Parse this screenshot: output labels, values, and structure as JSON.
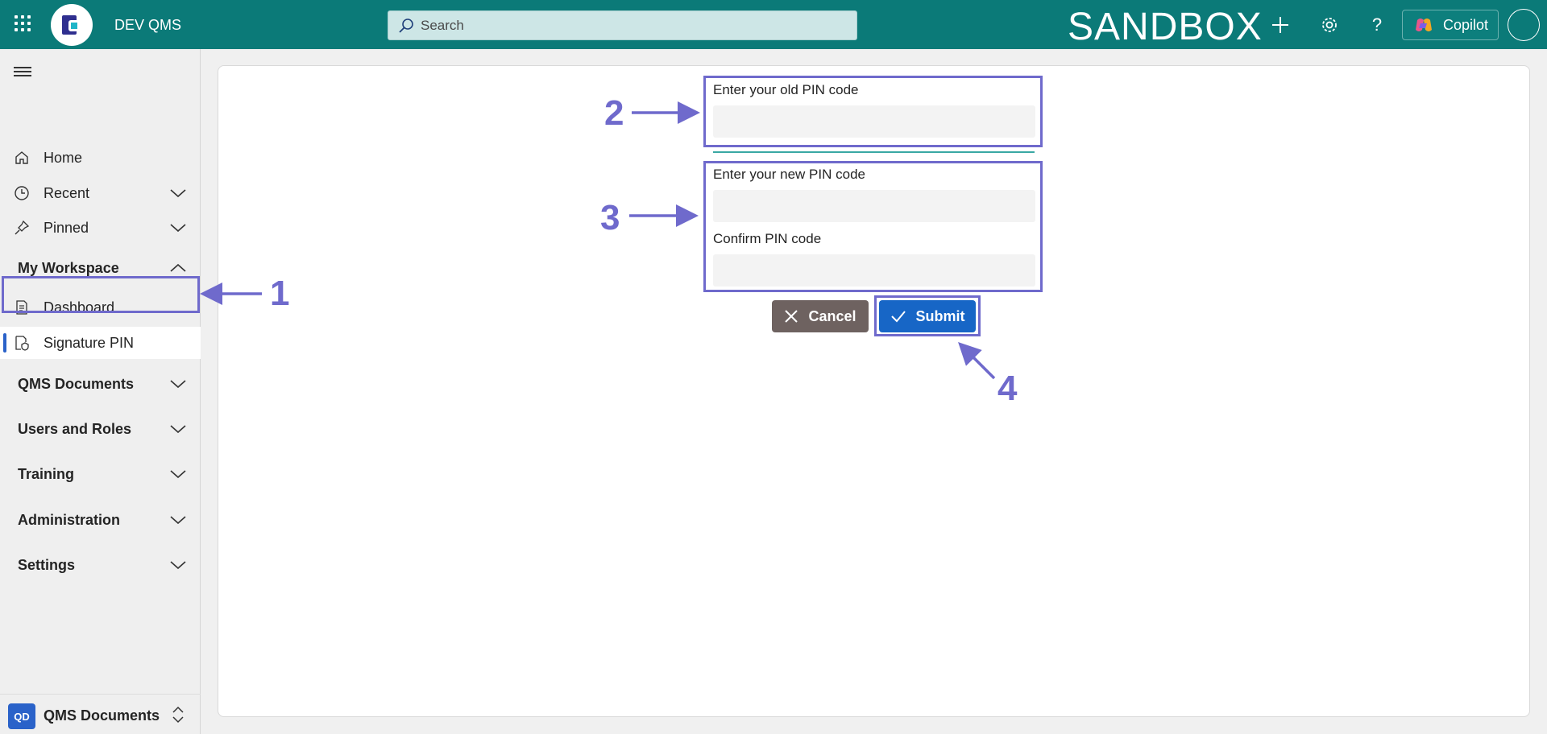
{
  "topbar": {
    "app_name": "DEV QMS",
    "search_placeholder": "Search",
    "environment": "SANDBOX",
    "copilot_label": "Copilot"
  },
  "sidebar": {
    "items": [
      {
        "label": "Home",
        "icon": "home-icon"
      },
      {
        "label": "Recent",
        "icon": "clock-icon"
      },
      {
        "label": "Pinned",
        "icon": "pin-icon"
      }
    ],
    "group_workspace": "My Workspace",
    "workspace_items": [
      {
        "label": "Dashboard",
        "icon": "dashboard-icon"
      },
      {
        "label": "Signature PIN",
        "icon": "shield-document-icon",
        "selected": true
      }
    ],
    "groups": [
      "QMS Documents",
      "Users and Roles",
      "Training",
      "Administration",
      "Settings"
    ],
    "footer": {
      "badge": "QD",
      "label": "QMS Documents"
    }
  },
  "form": {
    "old_pin_label": "Enter your old PIN code",
    "new_pin_label": "Enter your new PIN code",
    "confirm_pin_label": "Confirm PIN code",
    "cancel_label": "Cancel",
    "submit_label": "Submit"
  },
  "annotations": {
    "n1": "1",
    "n2": "2",
    "n3": "3",
    "n4": "4",
    "color": "#6f6acc"
  },
  "colors": {
    "topbar": "#0b7a78",
    "cancel": "#6e6260",
    "submit": "#1766c6",
    "selected_bar": "#2a62c9"
  }
}
